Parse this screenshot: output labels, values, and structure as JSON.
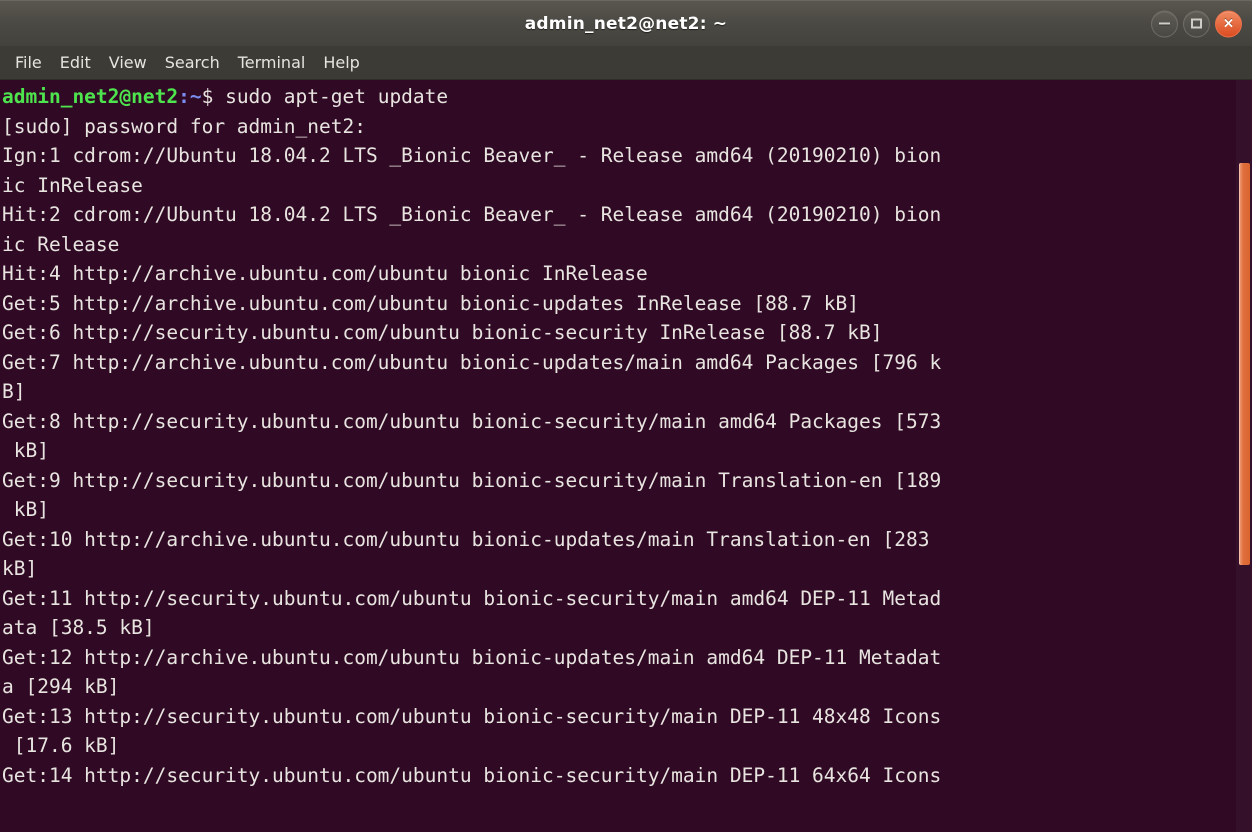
{
  "window": {
    "title": "admin_net2@net2: ~",
    "buttons": [
      {
        "name": "minimize",
        "label": "–"
      },
      {
        "name": "maximize",
        "label": "□"
      },
      {
        "name": "close",
        "label": "×"
      }
    ]
  },
  "menubar": {
    "items": [
      {
        "label": "File"
      },
      {
        "label": "Edit"
      },
      {
        "label": "View"
      },
      {
        "label": "Search"
      },
      {
        "label": "Terminal"
      },
      {
        "label": "Help"
      }
    ]
  },
  "terminal": {
    "prompt": {
      "user_host": "admin_net2@net2",
      "path": ":~",
      "symbol": "$ ",
      "command": "sudo apt-get update"
    },
    "lines": [
      "[sudo] password for admin_net2:",
      "Ign:1 cdrom://Ubuntu 18.04.2 LTS _Bionic Beaver_ - Release amd64 (20190210) bion",
      "ic InRelease",
      "Hit:2 cdrom://Ubuntu 18.04.2 LTS _Bionic Beaver_ - Release amd64 (20190210) bion",
      "ic Release",
      "Hit:4 http://archive.ubuntu.com/ubuntu bionic InRelease",
      "Get:5 http://archive.ubuntu.com/ubuntu bionic-updates InRelease [88.7 kB]",
      "Get:6 http://security.ubuntu.com/ubuntu bionic-security InRelease [88.7 kB]",
      "Get:7 http://archive.ubuntu.com/ubuntu bionic-updates/main amd64 Packages [796 k",
      "B]",
      "Get:8 http://security.ubuntu.com/ubuntu bionic-security/main amd64 Packages [573",
      " kB]",
      "Get:9 http://security.ubuntu.com/ubuntu bionic-security/main Translation-en [189",
      " kB]",
      "Get:10 http://archive.ubuntu.com/ubuntu bionic-updates/main Translation-en [283",
      "kB]",
      "Get:11 http://security.ubuntu.com/ubuntu bionic-security/main amd64 DEP-11 Metad",
      "ata [38.5 kB]",
      "Get:12 http://archive.ubuntu.com/ubuntu bionic-updates/main amd64 DEP-11 Metadat",
      "a [294 kB]",
      "Get:13 http://security.ubuntu.com/ubuntu bionic-security/main DEP-11 48x48 Icons",
      " [17.6 kB]",
      "Get:14 http://security.ubuntu.com/ubuntu bionic-security/main DEP-11 64x64 Icons"
    ]
  },
  "colors": {
    "terminal_background": "#300a24",
    "terminal_foreground": "#e8e4e0",
    "prompt_user": "#4ee44e",
    "prompt_path": "#7b8cf0",
    "titlebar": "#4c4a44",
    "menubar": "#3d3b36",
    "scrollbar_thumb": "#e06e3c",
    "close_button": "#db4c20"
  }
}
